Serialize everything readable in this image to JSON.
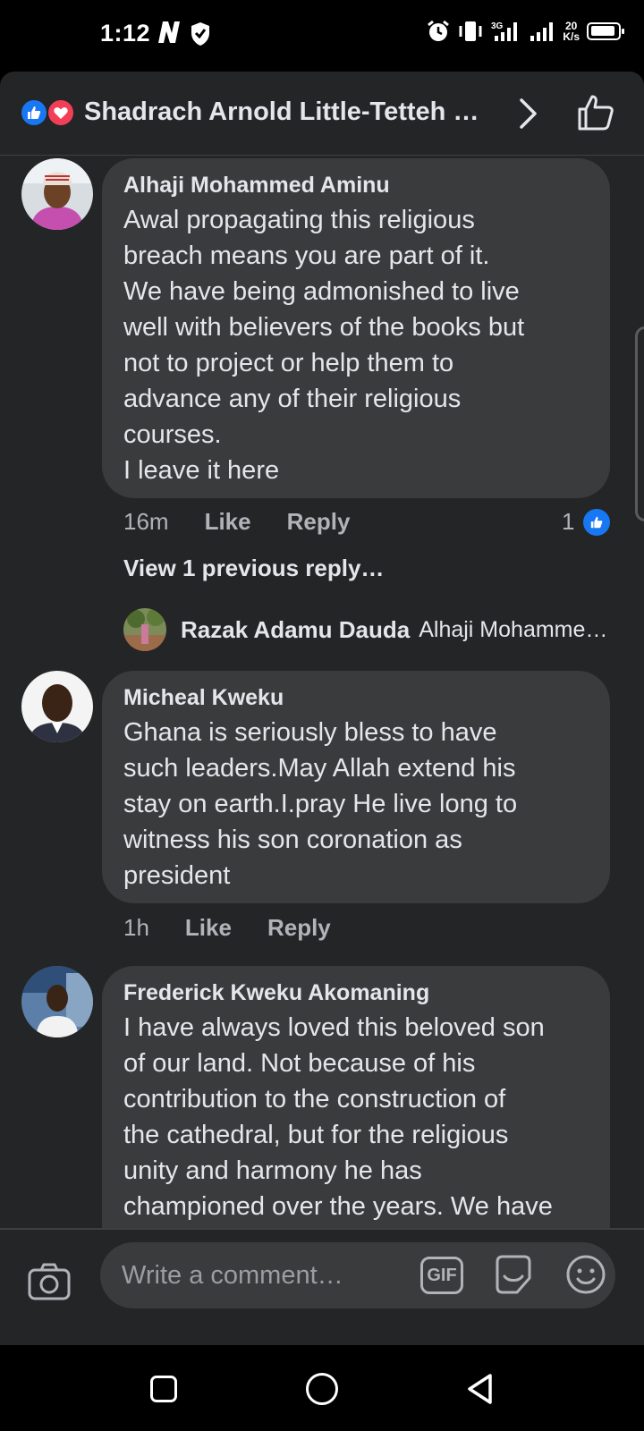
{
  "status_bar": {
    "time": "1:12",
    "net_speed_value": "20",
    "net_speed_unit": "K/s"
  },
  "header": {
    "title": "Shadrach Arnold Little-Tetteh …"
  },
  "comments": [
    {
      "author": "Alhaji Mohammed Aminu",
      "text": "Awal propagating this religious\nbreach means you are part of it.\nWe have being admonished to live\nwell with believers of the books but\nnot to project or help them to\nadvance any of their religious\ncourses.\nI leave it here",
      "time": "16m",
      "like_label": "Like",
      "reply_label": "Reply",
      "reaction_count": "1",
      "view_previous": "View 1 previous reply…",
      "reply_preview": {
        "author": "Razak Adamu Dauda",
        "text": "Alhaji Mohamme…"
      }
    },
    {
      "author": "Micheal Kweku",
      "text": "Ghana is seriously bless to have\nsuch leaders.May Allah extend his\nstay on earth.I.pray He live long to\nwitness his son coronation as\npresident",
      "time": "1h",
      "like_label": "Like",
      "reply_label": "Reply"
    },
    {
      "author": "Frederick Kweku Akomaning",
      "text": "I have always loved this beloved son\nof our land. Not because of his\ncontribution to the construction of\nthe cathedral, but for the religious\nunity and harmony he has\nchampioned over the years. We have"
    }
  ],
  "composer": {
    "placeholder": "Write a comment…",
    "gif_label": "GIF"
  },
  "colors": {
    "background": "#242526",
    "bubble": "#3a3b3c",
    "like_blue": "#1877f2",
    "love_red": "#f33e58"
  }
}
